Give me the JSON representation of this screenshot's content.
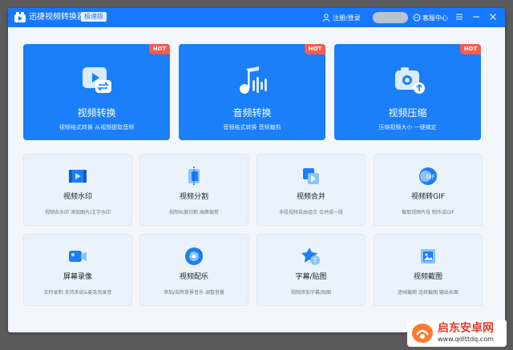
{
  "window": {
    "title": "迅捷视频转换器",
    "edition_badge": "极速版",
    "login_label": "注册/登录",
    "help_label": "客服中心"
  },
  "colors": {
    "brand": "#1677ff",
    "hot": "#ff5a4a",
    "tool_bg": "#eaf3fc"
  },
  "featured": [
    {
      "title": "视频转换",
      "subtitle": "视频格式转换 从视频提取音频",
      "badge": "HOT",
      "icon": "video-convert-icon"
    },
    {
      "title": "音频转换",
      "subtitle": "音频格式转换 音频裁剪",
      "badge": "HOT",
      "icon": "audio-convert-icon"
    },
    {
      "title": "视频压缩",
      "subtitle": "压缩视频大小 一键搞定",
      "badge": "HOT",
      "icon": "video-compress-icon"
    }
  ],
  "tools": [
    {
      "title": "视频水印",
      "subtitle": "视频去水印 添加图片/文字水印",
      "icon": "watermark-icon"
    },
    {
      "title": "视频分割",
      "subtitle": "视频长度切割 画面裁剪",
      "icon": "split-icon"
    },
    {
      "title": "视频合并",
      "subtitle": "多段视频自由组合 合并成一段",
      "icon": "merge-icon"
    },
    {
      "title": "视频转GIF",
      "subtitle": "截取视频片段 制作成GIF",
      "icon": "gif-icon"
    },
    {
      "title": "屏幕录像",
      "subtitle": "实时录制 支持系统&麦克风录音",
      "icon": "screen-record-icon"
    },
    {
      "title": "视频配乐",
      "subtitle": "添加/去除背景音乐 调整音量",
      "icon": "music-icon"
    },
    {
      "title": "字幕/贴图",
      "subtitle": "视频添加字幕/贴图",
      "icon": "subtitle-sticker-icon"
    },
    {
      "title": "视频截图",
      "subtitle": "逐帧截图 连续截图 输出长图",
      "icon": "screenshot-icon"
    }
  ],
  "watermark": {
    "line1": "启东安卓网",
    "line2": "www.qdlttdq.com"
  }
}
